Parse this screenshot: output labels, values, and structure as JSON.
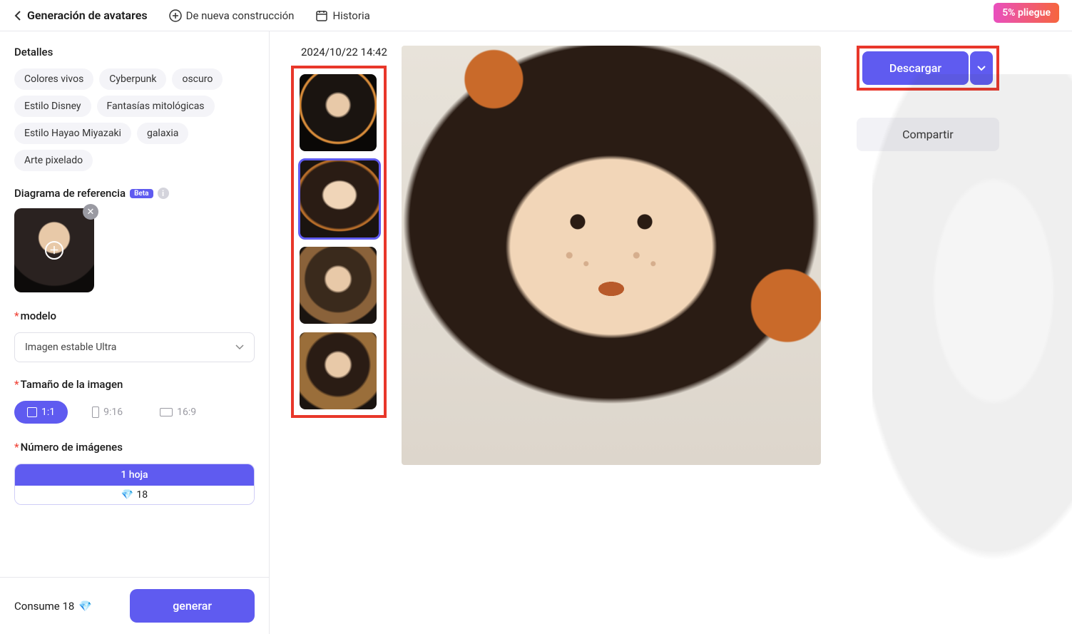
{
  "header": {
    "title": "Generación de avatares",
    "nav_new": "De nueva construcción",
    "nav_history": "Historia",
    "promo": "5% pliegue"
  },
  "sidebar": {
    "details_title": "Detalles",
    "tags": [
      "Colores vivos",
      "Cyberpunk",
      "oscuro",
      "Estilo Disney",
      "Fantasías mitológicas",
      "Estilo Hayao Miyazaki",
      "galaxia",
      "Arte pixelado"
    ],
    "reference_title": "Diagrama de referencia",
    "beta": "Beta",
    "model_label": "modelo",
    "model_value": "Imagen estable Ultra",
    "size_label": "Tamaño de la imagen",
    "ratios": {
      "r1": "1:1",
      "r2": "9:16",
      "r3": "16:9"
    },
    "count_label": "Número de imágenes",
    "count_value": "1 hoja",
    "count_cost": "18",
    "consume": "Consume 18",
    "generate": "generar"
  },
  "main": {
    "timestamp": "2024/10/22 14:42",
    "download": "Descargar",
    "share": "Compartir"
  }
}
